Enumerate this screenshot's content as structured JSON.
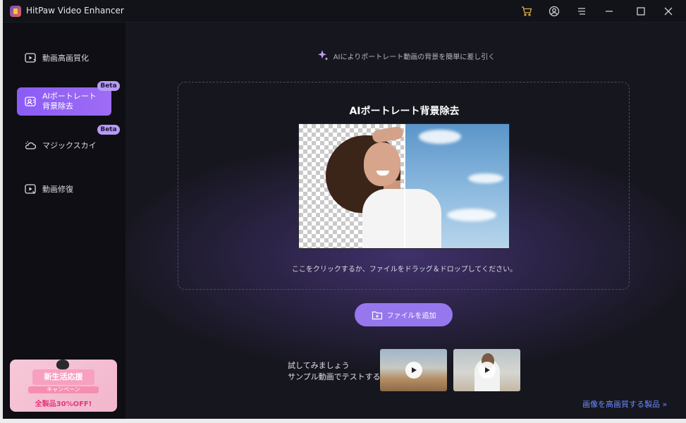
{
  "window": {
    "title": "HitPaw Video Enhancer",
    "icons": [
      "cart-icon",
      "account-icon",
      "menu-icon",
      "minimize-icon",
      "maximize-icon",
      "close-icon"
    ]
  },
  "sidebar": {
    "items": [
      {
        "label": "動画高画質化",
        "icon": "video-enhance-icon",
        "active": false
      },
      {
        "label": "AIポートレート背景除去",
        "icon": "portrait-icon",
        "active": true,
        "badge": "Beta"
      },
      {
        "label": "マジックスカイ",
        "icon": "sky-icon",
        "active": false,
        "badge": "Beta"
      },
      {
        "label": "動画修復",
        "icon": "video-repair-icon",
        "active": false
      }
    ],
    "promo": {
      "title": "新生活応援",
      "subtitle": "キャンペーン",
      "bottom": "全製品30%OFF!"
    }
  },
  "main": {
    "hint": "AIによりポートレート動画の背景を簡単に差し引く",
    "drop_title": "AIポートレート背景除去",
    "drop_text": "ここをクリックするか、ファイルをドラッグ＆ドロップしてください。",
    "add_button": "ファイルを追加",
    "sample_line1": "試してみましょう",
    "sample_line2": "サンプル動画でテストする",
    "link": "画像を高画質する製品 »"
  },
  "colors": {
    "accent": "#9677ee",
    "active_nav": "#8b5cf6",
    "link": "#6b8cff",
    "background": "#16161e"
  }
}
